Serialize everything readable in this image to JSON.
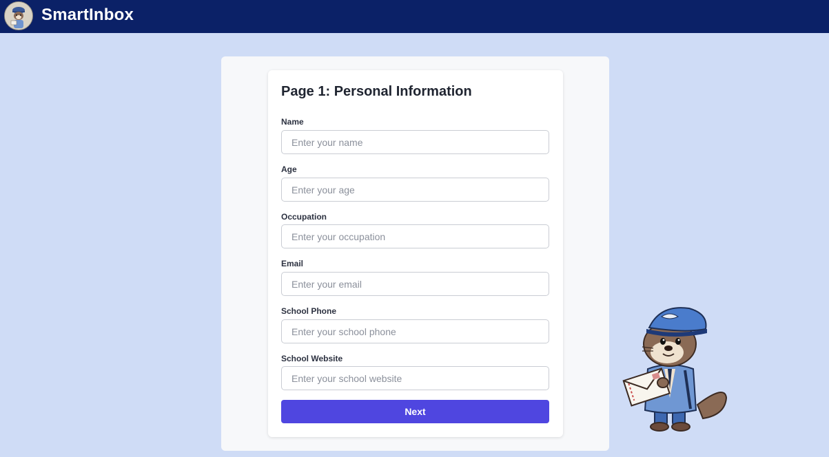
{
  "app": {
    "name": "SmartInbox",
    "logo_icon": "otter-mailcarrier-avatar-icon"
  },
  "form": {
    "title": "Page 1: Personal Information",
    "fields": [
      {
        "label": "Name",
        "placeholder": "Enter your name",
        "value": ""
      },
      {
        "label": "Age",
        "placeholder": "Enter your age",
        "value": ""
      },
      {
        "label": "Occupation",
        "placeholder": "Enter your occupation",
        "value": ""
      },
      {
        "label": "Email",
        "placeholder": "Enter your email",
        "value": ""
      },
      {
        "label": "School Phone",
        "placeholder": "Enter your school phone",
        "value": ""
      },
      {
        "label": "School Website",
        "placeholder": "Enter your school website",
        "value": ""
      }
    ],
    "next_label": "Next"
  },
  "mascot": {
    "icon": "otter-mailcarrier-mascot-icon"
  },
  "colors": {
    "header_bg": "#0b2167",
    "page_bg": "#cfdcf6",
    "button_bg": "#4f46e0"
  }
}
